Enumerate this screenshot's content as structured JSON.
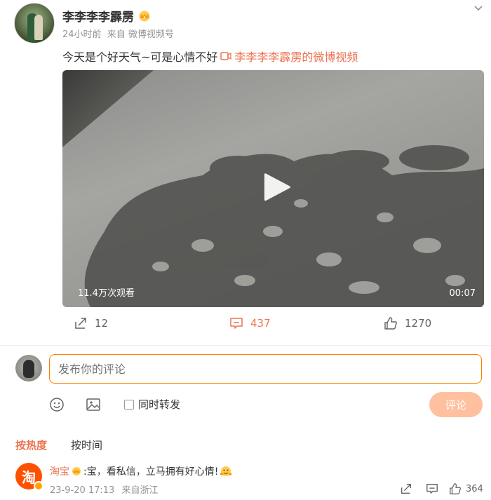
{
  "post": {
    "author": "李李李李霹雳",
    "time": "24小时前",
    "source": "来自 微博视频号",
    "text": "今天是个好天气~可是心情不好",
    "link_text": "李李李李霹雳的微博视频",
    "video": {
      "views": "11.4万次观看",
      "duration": "00:07"
    },
    "actions": {
      "shares": "12",
      "comments": "437",
      "likes": "1270"
    }
  },
  "composer": {
    "placeholder": "发布你的评论",
    "repost_label": "同时转发",
    "submit_label": "评论"
  },
  "sort_tabs": {
    "hot": "按热度",
    "time": "按时间"
  },
  "comments": [
    {
      "author": "淘宝",
      "avatar_char": "淘",
      "text": ":宝，看私信，立马拥有好心情!",
      "date": "23-9-20 17:13",
      "location": "来自浙江",
      "likes": "364"
    }
  ],
  "colors": {
    "accent": "#eb7350",
    "brand_orange": "#ff8200",
    "button_disabled": "#ffc09f"
  },
  "icons": [
    "crown-icon",
    "more-icon",
    "video-link-icon",
    "play-icon",
    "share-icon",
    "comment-icon",
    "like-icon",
    "emoji-icon",
    "image-icon",
    "verified-badge-icon",
    "hug-emoji-icon"
  ]
}
